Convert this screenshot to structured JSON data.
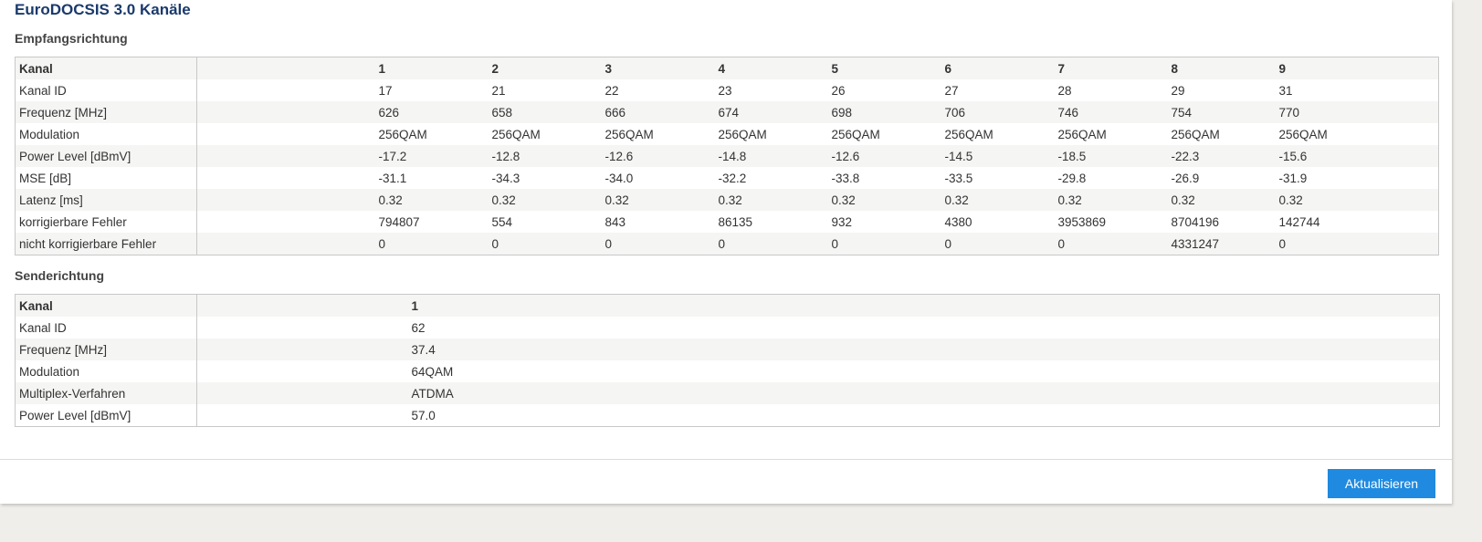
{
  "page_title": "EuroDOCSIS 3.0 Kanäle",
  "downstream": {
    "title": "Empfangsrichtung",
    "header": {
      "label": "Kanal",
      "values": [
        "1",
        "2",
        "3",
        "4",
        "5",
        "6",
        "7",
        "8",
        "9"
      ]
    },
    "rows": [
      {
        "label": "Kanal ID",
        "values": [
          "17",
          "21",
          "22",
          "23",
          "26",
          "27",
          "28",
          "29",
          "31"
        ]
      },
      {
        "label": "Frequenz [MHz]",
        "values": [
          "626",
          "658",
          "666",
          "674",
          "698",
          "706",
          "746",
          "754",
          "770"
        ]
      },
      {
        "label": "Modulation",
        "values": [
          "256QAM",
          "256QAM",
          "256QAM",
          "256QAM",
          "256QAM",
          "256QAM",
          "256QAM",
          "256QAM",
          "256QAM"
        ]
      },
      {
        "label": "Power Level [dBmV]",
        "values": [
          "-17.2",
          "-12.8",
          "-12.6",
          "-14.8",
          "-12.6",
          "-14.5",
          "-18.5",
          "-22.3",
          "-15.6"
        ]
      },
      {
        "label": "MSE [dB]",
        "values": [
          "-31.1",
          "-34.3",
          "-34.0",
          "-32.2",
          "-33.8",
          "-33.5",
          "-29.8",
          "-26.9",
          "-31.9"
        ]
      },
      {
        "label": "Latenz [ms]",
        "values": [
          "0.32",
          "0.32",
          "0.32",
          "0.32",
          "0.32",
          "0.32",
          "0.32",
          "0.32",
          "0.32"
        ]
      },
      {
        "label": "korrigierbare Fehler",
        "values": [
          "794807",
          "554",
          "843",
          "86135",
          "932",
          "4380",
          "3953869",
          "8704196",
          "142744"
        ]
      },
      {
        "label": "nicht korrigierbare Fehler",
        "values": [
          "0",
          "0",
          "0",
          "0",
          "0",
          "0",
          "0",
          "4331247",
          "0"
        ]
      }
    ]
  },
  "upstream": {
    "title": "Senderichtung",
    "header": {
      "label": "Kanal",
      "values": [
        "1"
      ]
    },
    "rows": [
      {
        "label": "Kanal ID",
        "values": [
          "62"
        ]
      },
      {
        "label": "Frequenz [MHz]",
        "values": [
          "37.4"
        ]
      },
      {
        "label": "Modulation",
        "values": [
          "64QAM"
        ]
      },
      {
        "label": "Multiplex-Verfahren",
        "values": [
          "ATDMA"
        ]
      },
      {
        "label": "Power Level [dBmV]",
        "values": [
          "57.0"
        ]
      }
    ]
  },
  "actions": {
    "refresh_label": "Aktualisieren"
  },
  "colors": {
    "accent": "#1f8ae0",
    "title": "#1a3a6c"
  }
}
